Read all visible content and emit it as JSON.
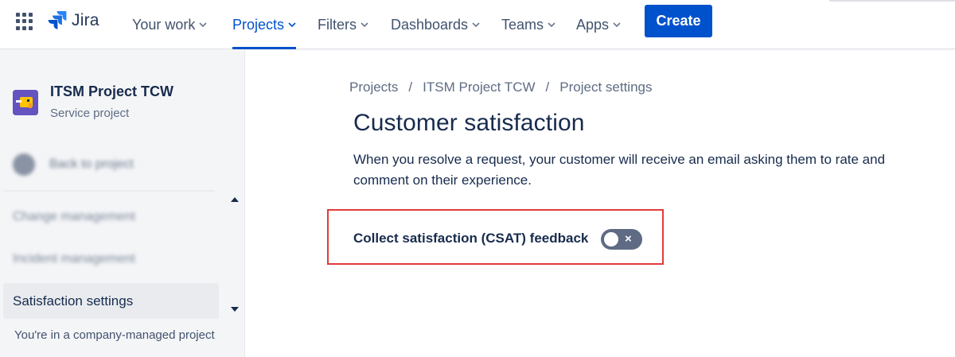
{
  "nav": {
    "logo_text": "Jira",
    "items": [
      {
        "label": "Your work"
      },
      {
        "label": "Projects"
      },
      {
        "label": "Filters"
      },
      {
        "label": "Dashboards"
      },
      {
        "label": "Teams"
      },
      {
        "label": "Apps"
      }
    ],
    "active_item": "Projects",
    "create_label": "Create"
  },
  "sidebar": {
    "project_name": "ITSM Project TCW",
    "project_type": "Service project",
    "back_label": "Back to project",
    "items": [
      {
        "label": "Change management"
      },
      {
        "label": "Incident management"
      },
      {
        "label": "Satisfaction settings"
      }
    ],
    "selected_item": "Satisfaction settings",
    "footer": "You're in a company-managed project"
  },
  "breadcrumb": [
    "Projects",
    "ITSM Project TCW",
    "Project settings"
  ],
  "breadcrumb_separator": "/",
  "main": {
    "title": "Customer satisfaction",
    "description": "When you resolve a request, your customer will receive an email asking them to rate and comment on their experience.",
    "csat_label": "Collect satisfaction (CSAT) feedback",
    "csat_enabled": false,
    "toggle_icon": "×"
  },
  "colors": {
    "brand_blue": "#0052cc",
    "highlight_red": "#e23b3b",
    "toggle_off": "#5f6b84"
  }
}
